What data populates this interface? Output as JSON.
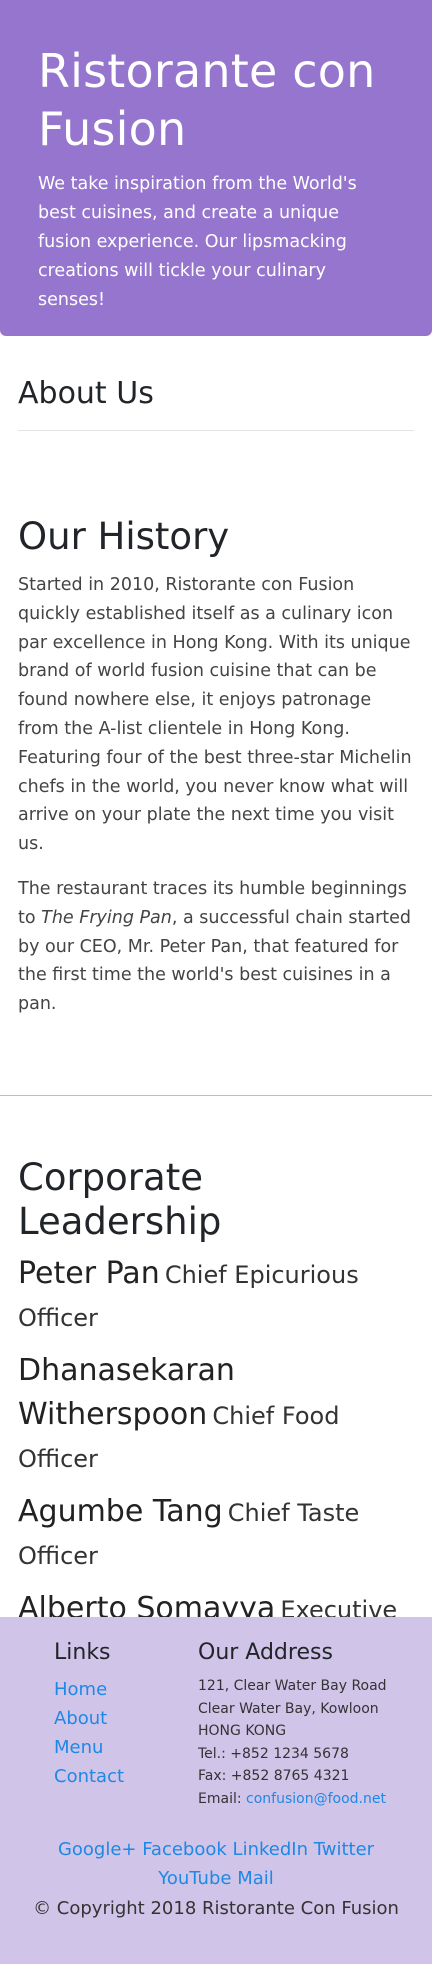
{
  "header": {
    "title": "Ristorante con Fusion",
    "tagline": "We take inspiration from the World's best cuisines, and create a unique fusion experience. Our lipsmacking creations will tickle your culinary senses!"
  },
  "about": {
    "title": "About Us"
  },
  "history": {
    "title": "Our History",
    "p1": "Started in 2010, Ristorante con Fusion quickly established itself as a culinary icon par excellence in Hong Kong. With its unique brand of world fusion cuisine that can be found nowhere else, it enjoys patronage from the A-list clientele in Hong Kong. Featuring four of the best three-star Michelin chefs in the world, you never know what will arrive on your plate the next time you visit us.",
    "p2_pre": "The restaurant traces its humble beginnings to ",
    "p2_em": "The Frying Pan",
    "p2_post": ", a successful chain started by our CEO, Mr. Peter Pan, that featured for the first time the world's best cuisines in a pan."
  },
  "leadership": {
    "title": "Corporate Leadership",
    "leaders": [
      {
        "name": "Peter Pan",
        "designation": "Chief Epicurious Officer"
      },
      {
        "name": "Dhanasekaran Witherspoon",
        "designation": "Chief Food Officer"
      },
      {
        "name": "Agumbe Tang",
        "designation": "Chief Taste Officer"
      },
      {
        "name": "Alberto Somayya",
        "designation": "Executive Chef"
      }
    ]
  },
  "footer": {
    "links_title": "Links",
    "links": [
      "Home",
      "About",
      "Menu",
      "Contact"
    ],
    "address_title": "Our Address",
    "address_lines": [
      "121, Clear Water Bay Road",
      "Clear Water Bay, Kowloon",
      "HONG KONG",
      "Tel.: +852 1234 5678",
      "Fax: +852 8765 4321"
    ],
    "email_label": "Email: ",
    "email": "confusion@food.net",
    "social": [
      "Google+",
      "Facebook",
      "LinkedIn",
      "Twitter",
      "YouTube",
      "Mail"
    ],
    "copyright": "© Copyright 2018 Ristorante Con Fusion"
  },
  "colors": {
    "jumbotron": "#9575cd",
    "footer": "#d1c4e9",
    "link": "#1e88e5"
  }
}
